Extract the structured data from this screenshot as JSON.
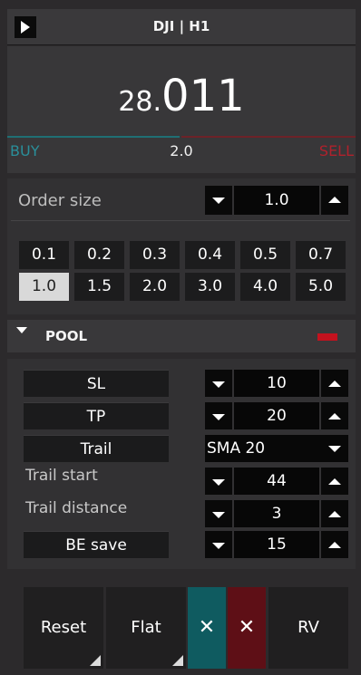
{
  "header": {
    "title": "DJI | H1",
    "toggle_icon": "play-icon"
  },
  "price": {
    "prefix": "28.",
    "main": "011"
  },
  "spread_bar": {
    "buy_label": "BUY",
    "sell_label": "SELL",
    "spread": "2.0",
    "buy_color": "#2a8f9a",
    "sell_color": "#b0212c"
  },
  "order_size": {
    "label": "Order size",
    "value": "1.0",
    "presets": [
      "0.1",
      "0.2",
      "0.3",
      "0.4",
      "0.5",
      "0.7",
      "1.0",
      "1.5",
      "2.0",
      "3.0",
      "4.0",
      "5.0"
    ],
    "active_preset": "1.0"
  },
  "pool": {
    "label": "POOL",
    "indicator_color": "#c3121e"
  },
  "params": {
    "sl": {
      "label": "SL",
      "value": "10"
    },
    "tp": {
      "label": "TP",
      "value": "20"
    },
    "trail": {
      "label": "Trail",
      "value": "SMA 20"
    },
    "trail_start": {
      "label": "Trail start",
      "value": "44"
    },
    "trail_distance": {
      "label": "Trail distance",
      "value": "3"
    },
    "be_save": {
      "label": "BE save",
      "value": "15"
    }
  },
  "actions": {
    "reset": "Reset",
    "flat": "Flat",
    "close_buy": "✕",
    "close_sell": "✕",
    "rv": "RV"
  }
}
